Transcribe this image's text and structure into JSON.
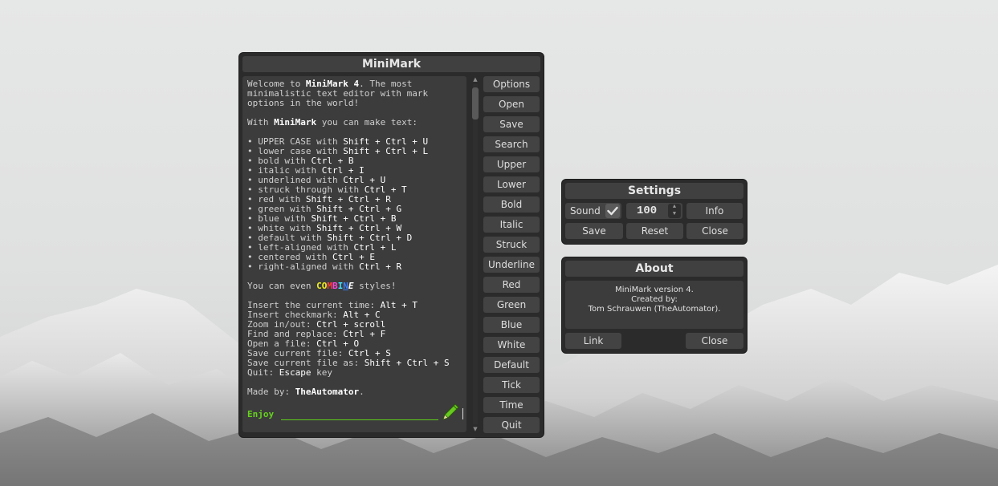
{
  "main": {
    "title": "MiniMark",
    "buttons": [
      "Options",
      "Open",
      "Save",
      "Search",
      "Upper",
      "Lower",
      "Bold",
      "Italic",
      "Struck",
      "Underline",
      "Red",
      "Green",
      "Blue",
      "White",
      "Default",
      "Tick",
      "Time",
      "Quit"
    ],
    "editor": {
      "intro_1_pre": "Welcome to ",
      "intro_1_app": "MiniMark 4",
      "intro_1_post": ". The most",
      "intro_2": "minimalistic text editor with mark",
      "intro_3": "options in the world!",
      "with_pre": "With ",
      "with_app": "MiniMark",
      "with_post": " you can make text:",
      "list": [
        {
          "label": "UPPER CASE with ",
          "keys": "Shift + Ctrl + U"
        },
        {
          "label": "lower case with ",
          "keys": "Shift + Ctrl + L"
        },
        {
          "label": "bold with ",
          "keys": "Ctrl + B"
        },
        {
          "label": "italic with ",
          "keys": "Ctrl + I"
        },
        {
          "label": "underlined with ",
          "keys": "Ctrl + U"
        },
        {
          "label": "struck through with ",
          "keys": "Ctrl + T"
        },
        {
          "label": "red with ",
          "keys": "Shift + Ctrl + R"
        },
        {
          "label": "green with ",
          "keys": "Shift + Ctrl + G"
        },
        {
          "label": "blue with ",
          "keys": "Shift + Ctrl + B"
        },
        {
          "label": "white with ",
          "keys": "Shift + Ctrl + W"
        },
        {
          "label": "default with ",
          "keys": "Shift + Ctrl + D"
        },
        {
          "label": "left-aligned with ",
          "keys": "Ctrl + L"
        },
        {
          "label": "centered with ",
          "keys": "Ctrl + E"
        },
        {
          "label": "right-aligned with ",
          "keys": "Ctrl + R"
        }
      ],
      "combine_pre": "You can even ",
      "combine_parts": [
        "CO",
        "M",
        "B",
        "I",
        "N",
        "E"
      ],
      "combine_post": " styles!",
      "shortcuts": [
        {
          "label": "Insert the current time: ",
          "keys": "Alt + T"
        },
        {
          "label": "Insert checkmark: ",
          "keys": "Alt + C"
        },
        {
          "label": "Zoom in/out: ",
          "keys": "Ctrl + scroll"
        },
        {
          "label": "Find and replace: ",
          "keys": "Ctrl + F"
        },
        {
          "label": "Open a file: ",
          "keys": "Ctrl + O"
        },
        {
          "label": "Save current file: ",
          "keys": "Ctrl + S"
        },
        {
          "label": "Save current file as: ",
          "keys": "Shift + Ctrl + S"
        },
        {
          "label": "Quit: ",
          "keys": "Escape",
          "suffix": " key"
        }
      ],
      "made_by_pre": "Made by: ",
      "made_by_name": "TheAutomator",
      "made_by_post": ".",
      "enjoy": "Enjoy"
    }
  },
  "settings": {
    "title": "Settings",
    "sound_label": "Sound",
    "sound_checked": true,
    "volume": "100",
    "info": "Info",
    "save": "Save",
    "reset": "Reset",
    "close": "Close"
  },
  "about": {
    "title": "About",
    "line1": "MiniMark version 4.",
    "line2": "Created by:",
    "line3": "Tom Schrauwen (TheAutomator).",
    "link": "Link",
    "close": "Close"
  },
  "colors": {
    "window": "#2b2b2b",
    "button": "#434343",
    "editor_bg": "#3c3c3c",
    "enjoy_green": "#66d21e"
  }
}
